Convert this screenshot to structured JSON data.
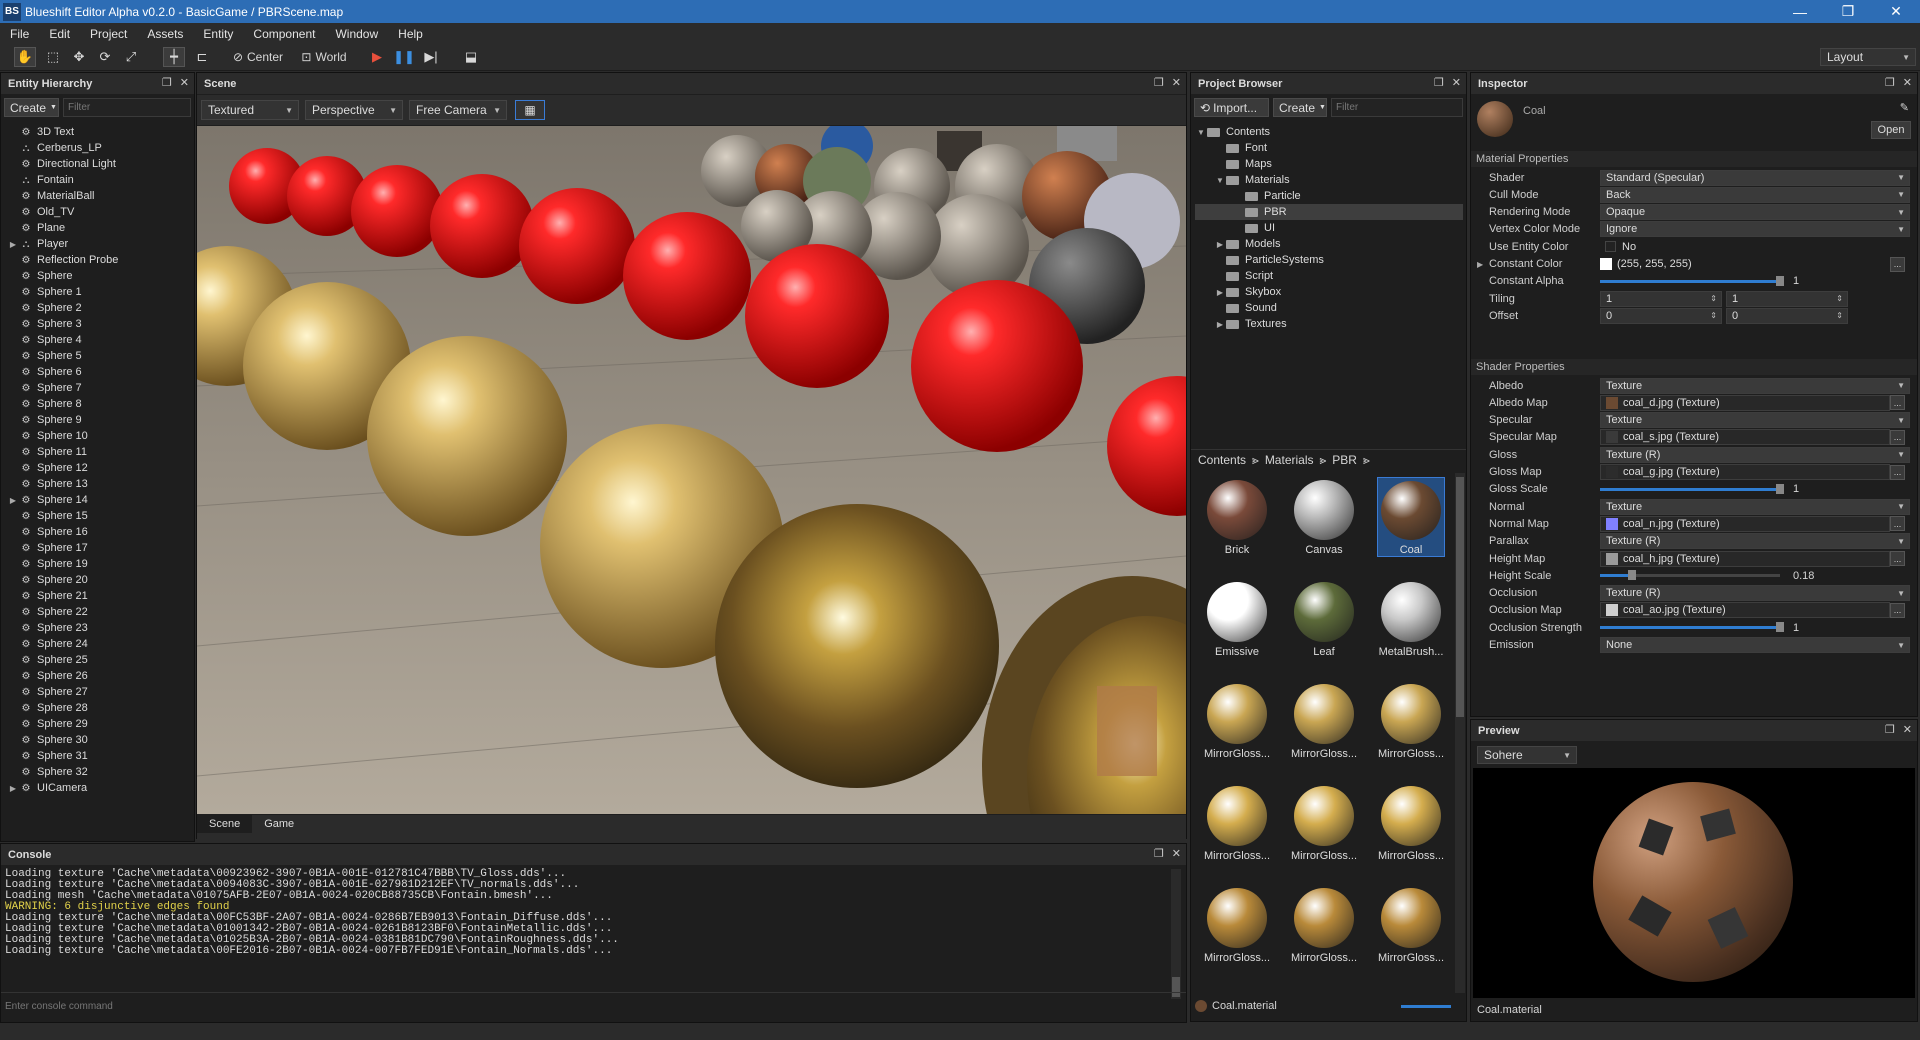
{
  "window": {
    "title": "Blueshift Editor Alpha v0.2.0 - BasicGame / PBRScene.map",
    "logo": "BS",
    "min": "—",
    "max": "❐",
    "close": "✕"
  },
  "menu": [
    "File",
    "Edit",
    "Project",
    "Assets",
    "Entity",
    "Component",
    "Window",
    "Help"
  ],
  "toolbar": {
    "center_label": "Center",
    "world_label": "World",
    "layout_label": "Layout"
  },
  "hierarchy": {
    "title": "Entity Hierarchy",
    "create_label": "Create",
    "filter_placeholder": "Filter",
    "items": [
      {
        "label": "3D Text",
        "expandable": false,
        "icon": "gear"
      },
      {
        "label": "Cerberus_LP",
        "expandable": false,
        "icon": "group"
      },
      {
        "label": "Directional Light",
        "expandable": false,
        "icon": "gear"
      },
      {
        "label": "Fontain",
        "expandable": false,
        "icon": "group"
      },
      {
        "label": "MaterialBall",
        "expandable": false,
        "icon": "gear"
      },
      {
        "label": "Old_TV",
        "expandable": false,
        "icon": "gear"
      },
      {
        "label": "Plane",
        "expandable": false,
        "icon": "gear"
      },
      {
        "label": "Player",
        "expandable": true,
        "icon": "group"
      },
      {
        "label": "Reflection Probe",
        "expandable": false,
        "icon": "gear"
      },
      {
        "label": "Sphere",
        "expandable": false,
        "icon": "gear"
      },
      {
        "label": "Sphere 1",
        "expandable": false,
        "icon": "gear"
      },
      {
        "label": "Sphere 2",
        "expandable": false,
        "icon": "gear"
      },
      {
        "label": "Sphere 3",
        "expandable": false,
        "icon": "gear"
      },
      {
        "label": "Sphere 4",
        "expandable": false,
        "icon": "gear"
      },
      {
        "label": "Sphere 5",
        "expandable": false,
        "icon": "gear"
      },
      {
        "label": "Sphere 6",
        "expandable": false,
        "icon": "gear"
      },
      {
        "label": "Sphere 7",
        "expandable": false,
        "icon": "gear"
      },
      {
        "label": "Sphere 8",
        "expandable": false,
        "icon": "gear"
      },
      {
        "label": "Sphere 9",
        "expandable": false,
        "icon": "gear"
      },
      {
        "label": "Sphere 10",
        "expandable": false,
        "icon": "gear"
      },
      {
        "label": "Sphere 11",
        "expandable": false,
        "icon": "gear"
      },
      {
        "label": "Sphere 12",
        "expandable": false,
        "icon": "gear"
      },
      {
        "label": "Sphere 13",
        "expandable": false,
        "icon": "gear"
      },
      {
        "label": "Sphere 14",
        "expandable": true,
        "icon": "gear"
      },
      {
        "label": "Sphere 15",
        "expandable": false,
        "icon": "gear"
      },
      {
        "label": "Sphere 16",
        "expandable": false,
        "icon": "gear"
      },
      {
        "label": "Sphere 17",
        "expandable": false,
        "icon": "gear"
      },
      {
        "label": "Sphere 19",
        "expandable": false,
        "icon": "gear"
      },
      {
        "label": "Sphere 20",
        "expandable": false,
        "icon": "gear"
      },
      {
        "label": "Sphere 21",
        "expandable": false,
        "icon": "gear"
      },
      {
        "label": "Sphere 22",
        "expandable": false,
        "icon": "gear"
      },
      {
        "label": "Sphere 23",
        "expandable": false,
        "icon": "gear"
      },
      {
        "label": "Sphere 24",
        "expandable": false,
        "icon": "gear"
      },
      {
        "label": "Sphere 25",
        "expandable": false,
        "icon": "gear"
      },
      {
        "label": "Sphere 26",
        "expandable": false,
        "icon": "gear"
      },
      {
        "label": "Sphere 27",
        "expandable": false,
        "icon": "gear"
      },
      {
        "label": "Sphere 28",
        "expandable": false,
        "icon": "gear"
      },
      {
        "label": "Sphere 29",
        "expandable": false,
        "icon": "gear"
      },
      {
        "label": "Sphere 30",
        "expandable": false,
        "icon": "gear"
      },
      {
        "label": "Sphere 31",
        "expandable": false,
        "icon": "gear"
      },
      {
        "label": "Sphere 32",
        "expandable": false,
        "icon": "gear"
      },
      {
        "label": "UICamera",
        "expandable": true,
        "icon": "gear"
      }
    ]
  },
  "scene": {
    "title": "Scene",
    "render_mode": "Textured",
    "projection": "Perspective",
    "camera": "Free Camera",
    "tabs": [
      "Scene",
      "Game"
    ]
  },
  "console": {
    "title": "Console",
    "placeholder": "Enter console command",
    "lines": [
      {
        "text": "Loading texture 'Cache\\metadata\\00923962-3907-0B1A-001E-012781C47BBB\\TV_Gloss.dds'...",
        "warn": false
      },
      {
        "text": "Loading texture 'Cache\\metadata\\0094083C-3907-0B1A-001E-027981D212EF\\TV_normals.dds'...",
        "warn": false
      },
      {
        "text": "Loading mesh 'Cache\\metadata\\01075AFB-2E07-0B1A-0024-020CB88735CB\\Fontain.bmesh'...",
        "warn": false
      },
      {
        "text": "WARNING: 6 disjunctive edges found",
        "warn": true
      },
      {
        "text": "Loading texture 'Cache\\metadata\\00FC53BF-2A07-0B1A-0024-0286B7EB9013\\Fontain_Diffuse.dds'...",
        "warn": false
      },
      {
        "text": "Loading texture 'Cache\\metadata\\01001342-2B07-0B1A-0024-0261B8123BF0\\FontainMetallic.dds'...",
        "warn": false
      },
      {
        "text": "Loading texture 'Cache\\metadata\\01025B3A-2B07-0B1A-0024-0381B81DC790\\FontainRoughness.dds'...",
        "warn": false
      },
      {
        "text": "Loading texture 'Cache\\metadata\\00FE2016-2B07-0B1A-0024-007FB7FED91E\\Fontain_Normals.dds'...",
        "warn": false
      }
    ]
  },
  "project": {
    "title": "Project Browser",
    "import_label": "Import...",
    "create_label": "Create",
    "filter_placeholder": "Filter",
    "folders": [
      {
        "label": "Contents",
        "depth": 0,
        "arrow": "open"
      },
      {
        "label": "Font",
        "depth": 1,
        "arrow": "none"
      },
      {
        "label": "Maps",
        "depth": 1,
        "arrow": "none"
      },
      {
        "label": "Materials",
        "depth": 1,
        "arrow": "open"
      },
      {
        "label": "Particle",
        "depth": 2,
        "arrow": "none"
      },
      {
        "label": "PBR",
        "depth": 2,
        "arrow": "none",
        "selected": true
      },
      {
        "label": "UI",
        "depth": 2,
        "arrow": "none"
      },
      {
        "label": "Models",
        "depth": 1,
        "arrow": "closed"
      },
      {
        "label": "ParticleSystems",
        "depth": 1,
        "arrow": "none"
      },
      {
        "label": "Script",
        "depth": 1,
        "arrow": "none"
      },
      {
        "label": "Skybox",
        "depth": 1,
        "arrow": "closed"
      },
      {
        "label": "Sound",
        "depth": 1,
        "arrow": "none"
      },
      {
        "label": "Textures",
        "depth": 1,
        "arrow": "closed"
      }
    ],
    "breadcrumb": [
      "Contents",
      "Materials",
      "PBR"
    ],
    "assets": [
      {
        "label": "Brick",
        "color": "#7a4a3a",
        "selected": false
      },
      {
        "label": "Canvas",
        "color": "#b8b8b8",
        "selected": false
      },
      {
        "label": "Coal",
        "color": "#6b4a32",
        "selected": true
      },
      {
        "label": "Emissive",
        "color": "#ffffff",
        "selected": false
      },
      {
        "label": "Leaf",
        "color": "#5d6b3a",
        "selected": false
      },
      {
        "label": "MetalBrush...",
        "color": "#c8c8c8",
        "selected": false
      },
      {
        "label": "MirrorGloss...",
        "color": "#c9a653",
        "selected": false
      },
      {
        "label": "MirrorGloss...",
        "color": "#c9a653",
        "selected": false
      },
      {
        "label": "MirrorGloss...",
        "color": "#c9a653",
        "selected": false
      },
      {
        "label": "MirrorGloss...",
        "color": "#d4ad4e",
        "selected": false
      },
      {
        "label": "MirrorGloss...",
        "color": "#d4ad4e",
        "selected": false
      },
      {
        "label": "MirrorGloss...",
        "color": "#d4ad4e",
        "selected": false
      },
      {
        "label": "MirrorGloss...",
        "color": "#b98a3a",
        "selected": false
      },
      {
        "label": "MirrorGloss...",
        "color": "#b98a3a",
        "selected": false
      },
      {
        "label": "MirrorGloss...",
        "color": "#b98a3a",
        "selected": false
      }
    ],
    "status": "Coal.material"
  },
  "inspector": {
    "title": "Inspector",
    "asset_name": "Coal",
    "open_label": "Open",
    "material_section": "Material Properties",
    "shader_section": "Shader Properties",
    "material_props": [
      {
        "label": "Shader",
        "value": "Standard (Specular)",
        "kind": "dropdown"
      },
      {
        "label": "Cull Mode",
        "value": "Back",
        "kind": "dropdown"
      },
      {
        "label": "Rendering Mode",
        "value": "Opaque",
        "kind": "dropdown"
      },
      {
        "label": "Vertex Color Mode",
        "value": "Ignore",
        "kind": "dropdown"
      },
      {
        "label": "Use Entity Color",
        "value": "No",
        "kind": "check"
      },
      {
        "label": "Constant Color",
        "value": "(255, 255, 255)",
        "kind": "color"
      },
      {
        "label": "Constant Alpha",
        "value": "1",
        "kind": "slider",
        "level": 1
      },
      {
        "label": "Tiling",
        "value": "1",
        "value2": "1",
        "kind": "vec2"
      },
      {
        "label": "Offset",
        "value": "0",
        "value2": "0",
        "kind": "vec2"
      }
    ],
    "shader_props": [
      {
        "label": "Albedo",
        "value": "Texture",
        "kind": "dropdown"
      },
      {
        "label": "Albedo Map",
        "value": "coal_d.jpg (Texture)",
        "kind": "texture",
        "color": "#6b4a32"
      },
      {
        "label": "Specular",
        "value": "Texture",
        "kind": "dropdown"
      },
      {
        "label": "Specular Map",
        "value": "coal_s.jpg (Texture)",
        "kind": "texture",
        "color": "#3a3a3a"
      },
      {
        "label": "Gloss",
        "value": "Texture (R)",
        "kind": "dropdown"
      },
      {
        "label": "Gloss Map",
        "value": "coal_g.jpg (Texture)",
        "kind": "texture",
        "color": "#2c2c2c"
      },
      {
        "label": "Gloss Scale",
        "value": "1",
        "kind": "slider",
        "level": 1
      },
      {
        "label": "Normal",
        "value": "Texture",
        "kind": "dropdown"
      },
      {
        "label": "Normal Map",
        "value": "coal_n.jpg (Texture)",
        "kind": "texture",
        "color": "#8080ff"
      },
      {
        "label": "Parallax",
        "value": "Texture (R)",
        "kind": "dropdown"
      },
      {
        "label": "Height Map",
        "value": "coal_h.jpg (Texture)",
        "kind": "texture",
        "color": "#9a9a9a"
      },
      {
        "label": "Height Scale",
        "value": "0.18",
        "kind": "slider",
        "level": 0.18
      },
      {
        "label": "Occlusion",
        "value": "Texture (R)",
        "kind": "dropdown"
      },
      {
        "label": "Occlusion Map",
        "value": "coal_ao.jpg (Texture)",
        "kind": "texture",
        "color": "#cfcfcf"
      },
      {
        "label": "Occlusion Strength",
        "value": "1",
        "kind": "slider",
        "level": 1
      },
      {
        "label": "Emission",
        "value": "None",
        "kind": "dropdown"
      }
    ]
  },
  "preview": {
    "title": "Preview",
    "mesh": "Sohere",
    "status": "Coal.material"
  }
}
